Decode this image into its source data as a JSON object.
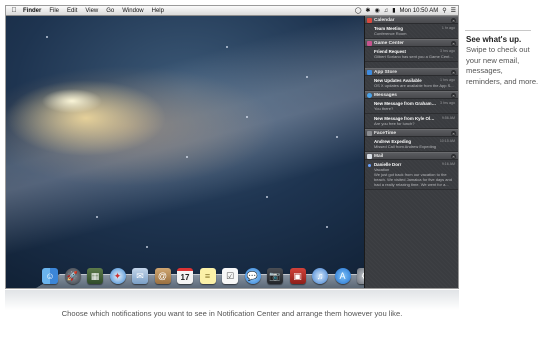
{
  "menubar": {
    "items": [
      "Finder",
      "File",
      "Edit",
      "View",
      "Go",
      "Window",
      "Help"
    ],
    "clock": "Mon 10:50 AM"
  },
  "notification_center": {
    "calendar": {
      "header": "Calendar",
      "items": [
        {
          "title": "Team Meeting",
          "detail": "Conference Room",
          "when": "1 hr ago"
        }
      ]
    },
    "game_center": {
      "header": "Game Center",
      "items": [
        {
          "title": "Friend Request",
          "detail": "Gilbert Soriano has sent you a Game Cent...",
          "when": "3 hrs ago"
        }
      ]
    },
    "app_store": {
      "header": "App Store",
      "items": [
        {
          "title": "New Updates Available",
          "detail": "OS X updates are available from the App S...",
          "when": "1 hrs ago"
        }
      ]
    },
    "messages": {
      "header": "Messages",
      "items": [
        {
          "title": "New Message from Graham Mi...",
          "detail": "You there?",
          "when": "3 hrs ago"
        },
        {
          "title": "New Message from Kyle Olson",
          "detail": "Are you free for lunch?",
          "when": "9:56 AM"
        }
      ]
    },
    "facetime": {
      "header": "FaceTime",
      "items": [
        {
          "title": "Andrew Expeding",
          "detail": "Missed Call from Andrew Expeding",
          "when": "10:15 AM"
        }
      ]
    },
    "mail": {
      "header": "Mail",
      "items": [
        {
          "title": "Danielle Dorr",
          "subtitle": "Vacation",
          "body": "We just got back from our vacation to the beach. We visited Jamaica for five days and had a really relaxing time. We went for a...",
          "when": "9:16 AM"
        }
      ]
    }
  },
  "dock": {
    "icons": [
      "finder-icon",
      "launchpad-icon",
      "mission-control-icon",
      "safari-icon",
      "mail-icon",
      "contacts-icon",
      "calendar-icon",
      "notes-icon",
      "reminders-icon",
      "messages-icon",
      "facetime-icon",
      "photo-booth-icon",
      "itunes-icon",
      "app-store-icon",
      "system-preferences-icon",
      "downloads-stack-icon",
      "trash-icon"
    ],
    "calendar_day": "17"
  },
  "side": {
    "title": "See what's up.",
    "description": "Swipe to check out your new email, messages, reminders, and more."
  },
  "caption": "Choose which notifications you want to see in Notification Center and arrange them however you like.",
  "colors": {
    "nc_background": "#3a3c40",
    "unread_dot": "#6aa2ff"
  }
}
